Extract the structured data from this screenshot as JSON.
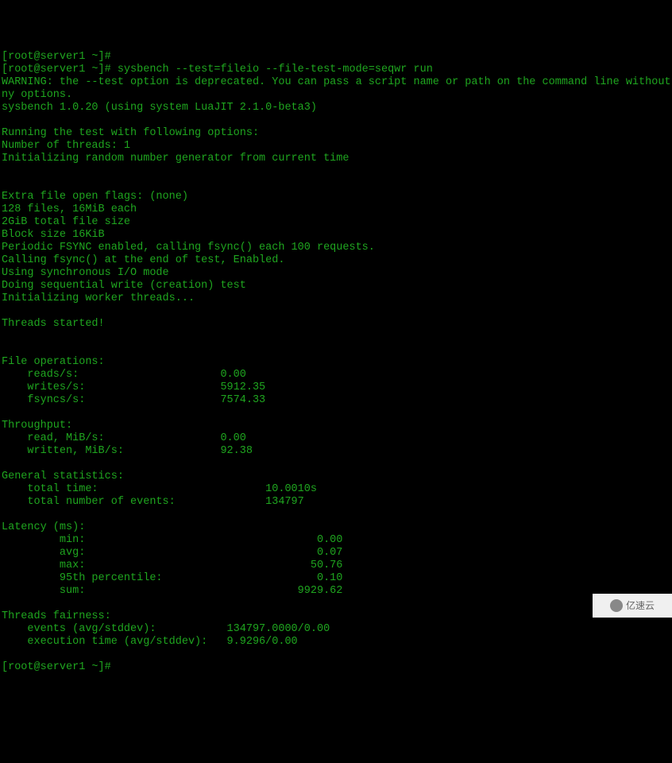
{
  "terminal": {
    "prompt1_prefix": "[root@server1 ~]# ",
    "command": "sysbench --test=fileio --file-test-mode=seqwr run",
    "warning": "WARNING: the --test option is deprecated. You can pass a script name or path on the command line without a\nny options.",
    "version": "sysbench 1.0.20 (using system LuaJIT 2.1.0-beta3)",
    "running_header": "Running the test with following options:",
    "threads_count": "Number of threads: 1",
    "init_rng": "Initializing random number generator from current time",
    "extra_flags": "Extra file open flags: (none)",
    "files_info": "128 files, 16MiB each",
    "total_size": "2GiB total file size",
    "block_size": "Block size 16KiB",
    "fsync_periodic": "Periodic FSYNC enabled, calling fsync() each 100 requests.",
    "fsync_end": "Calling fsync() at the end of test, Enabled.",
    "io_mode": "Using synchronous I/O mode",
    "test_type": "Doing sequential write (creation) test",
    "init_workers": "Initializing worker threads...",
    "threads_started": "Threads started!",
    "file_ops_header": "File operations:",
    "reads_line": "    reads/s:                      0.00",
    "writes_line": "    writes/s:                     5912.35",
    "fsyncs_line": "    fsyncs/s:                     7574.33",
    "throughput_header": "Throughput:",
    "read_mib": "    read, MiB/s:                  0.00",
    "written_mib": "    written, MiB/s:               92.38",
    "general_header": "General statistics:",
    "total_time": "    total time:                          10.0010s",
    "total_events": "    total number of events:              134797",
    "latency_header": "Latency (ms):",
    "latency_min": "         min:                                    0.00",
    "latency_avg": "         avg:                                    0.07",
    "latency_max": "         max:                                   50.76",
    "latency_95th": "         95th percentile:                        0.10",
    "latency_sum": "         sum:                                 9929.62",
    "fairness_header": "Threads fairness:",
    "fairness_events": "    events (avg/stddev):           134797.0000/0.00",
    "fairness_exec": "    execution time (avg/stddev):   9.9296/0.00",
    "prompt2": "[root@server1 ~]# "
  },
  "watermark": {
    "text": "亿速云"
  }
}
